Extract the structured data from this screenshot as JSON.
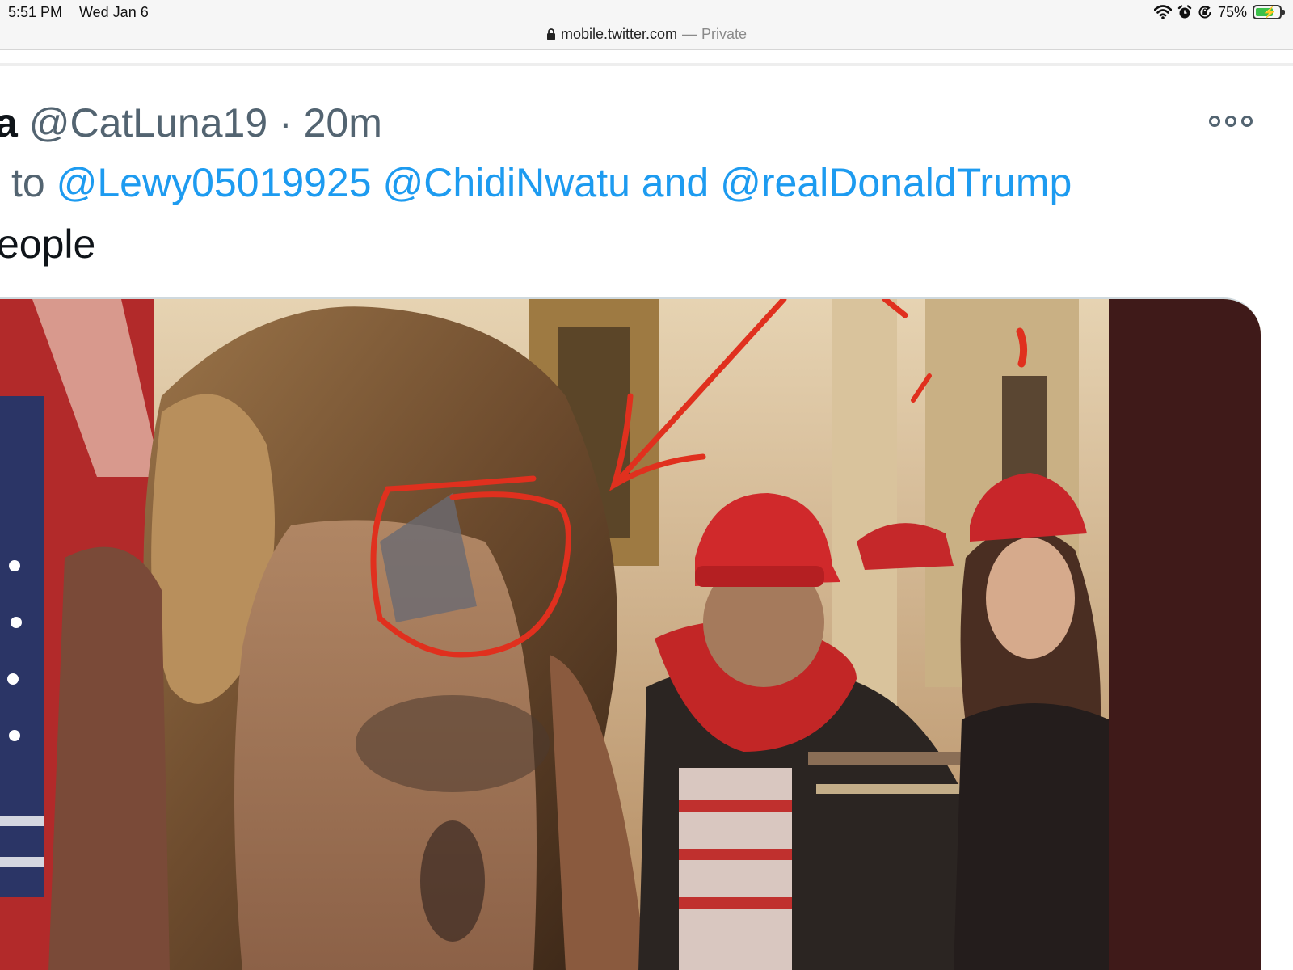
{
  "status_bar": {
    "time": "5:51 PM",
    "date": "Wed Jan 6",
    "battery": "75%",
    "battery_level": 0.75,
    "icons": [
      "wifi-icon",
      "alarm-icon",
      "orientation-lock-icon",
      "battery-icon"
    ]
  },
  "address_bar": {
    "lock_icon": "lock-icon",
    "url": "mobile.twitter.com",
    "separator": "—",
    "mode": "Private"
  },
  "tweet": {
    "author_name_fragment": "a",
    "handle": "@CatLuna19",
    "separator": "·",
    "time": "20m",
    "more_icon": "more-options-icon",
    "reply_prefix": "to",
    "mentions": [
      "@Lewy05019925",
      "@ChidiNwatu",
      "@realDonaldTrump"
    ],
    "reply_conjunction": "and",
    "text_fragment": "eople"
  },
  "media": {
    "description_icon": "photo-image",
    "annotation_color": "#e0301e"
  }
}
